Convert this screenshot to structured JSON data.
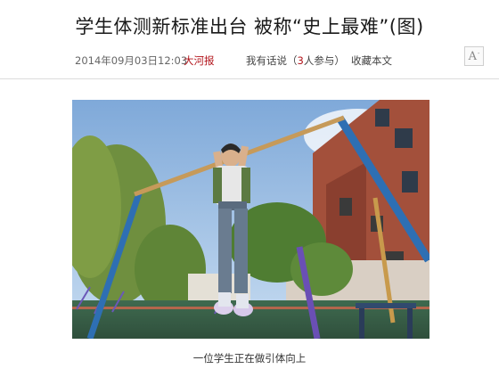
{
  "article": {
    "title": "学生体测新标准出台 被称“史上最难”(图)",
    "date": "2014年09月03日12:03",
    "source": "大河报",
    "comment_prefix": "我有话说（",
    "comment_count": "3",
    "comment_suffix": "人参与）",
    "favorite": "收藏本文",
    "font_size_button": "A",
    "font_size_button_sup": "-",
    "image_caption": "一位学生正在做引体向上"
  },
  "colors": {
    "source_link": "#b2141b",
    "comment_count": "#b2141b",
    "divider": "#dcdcdc"
  },
  "icons": {
    "font_size_toggle": "text-size-icon"
  }
}
